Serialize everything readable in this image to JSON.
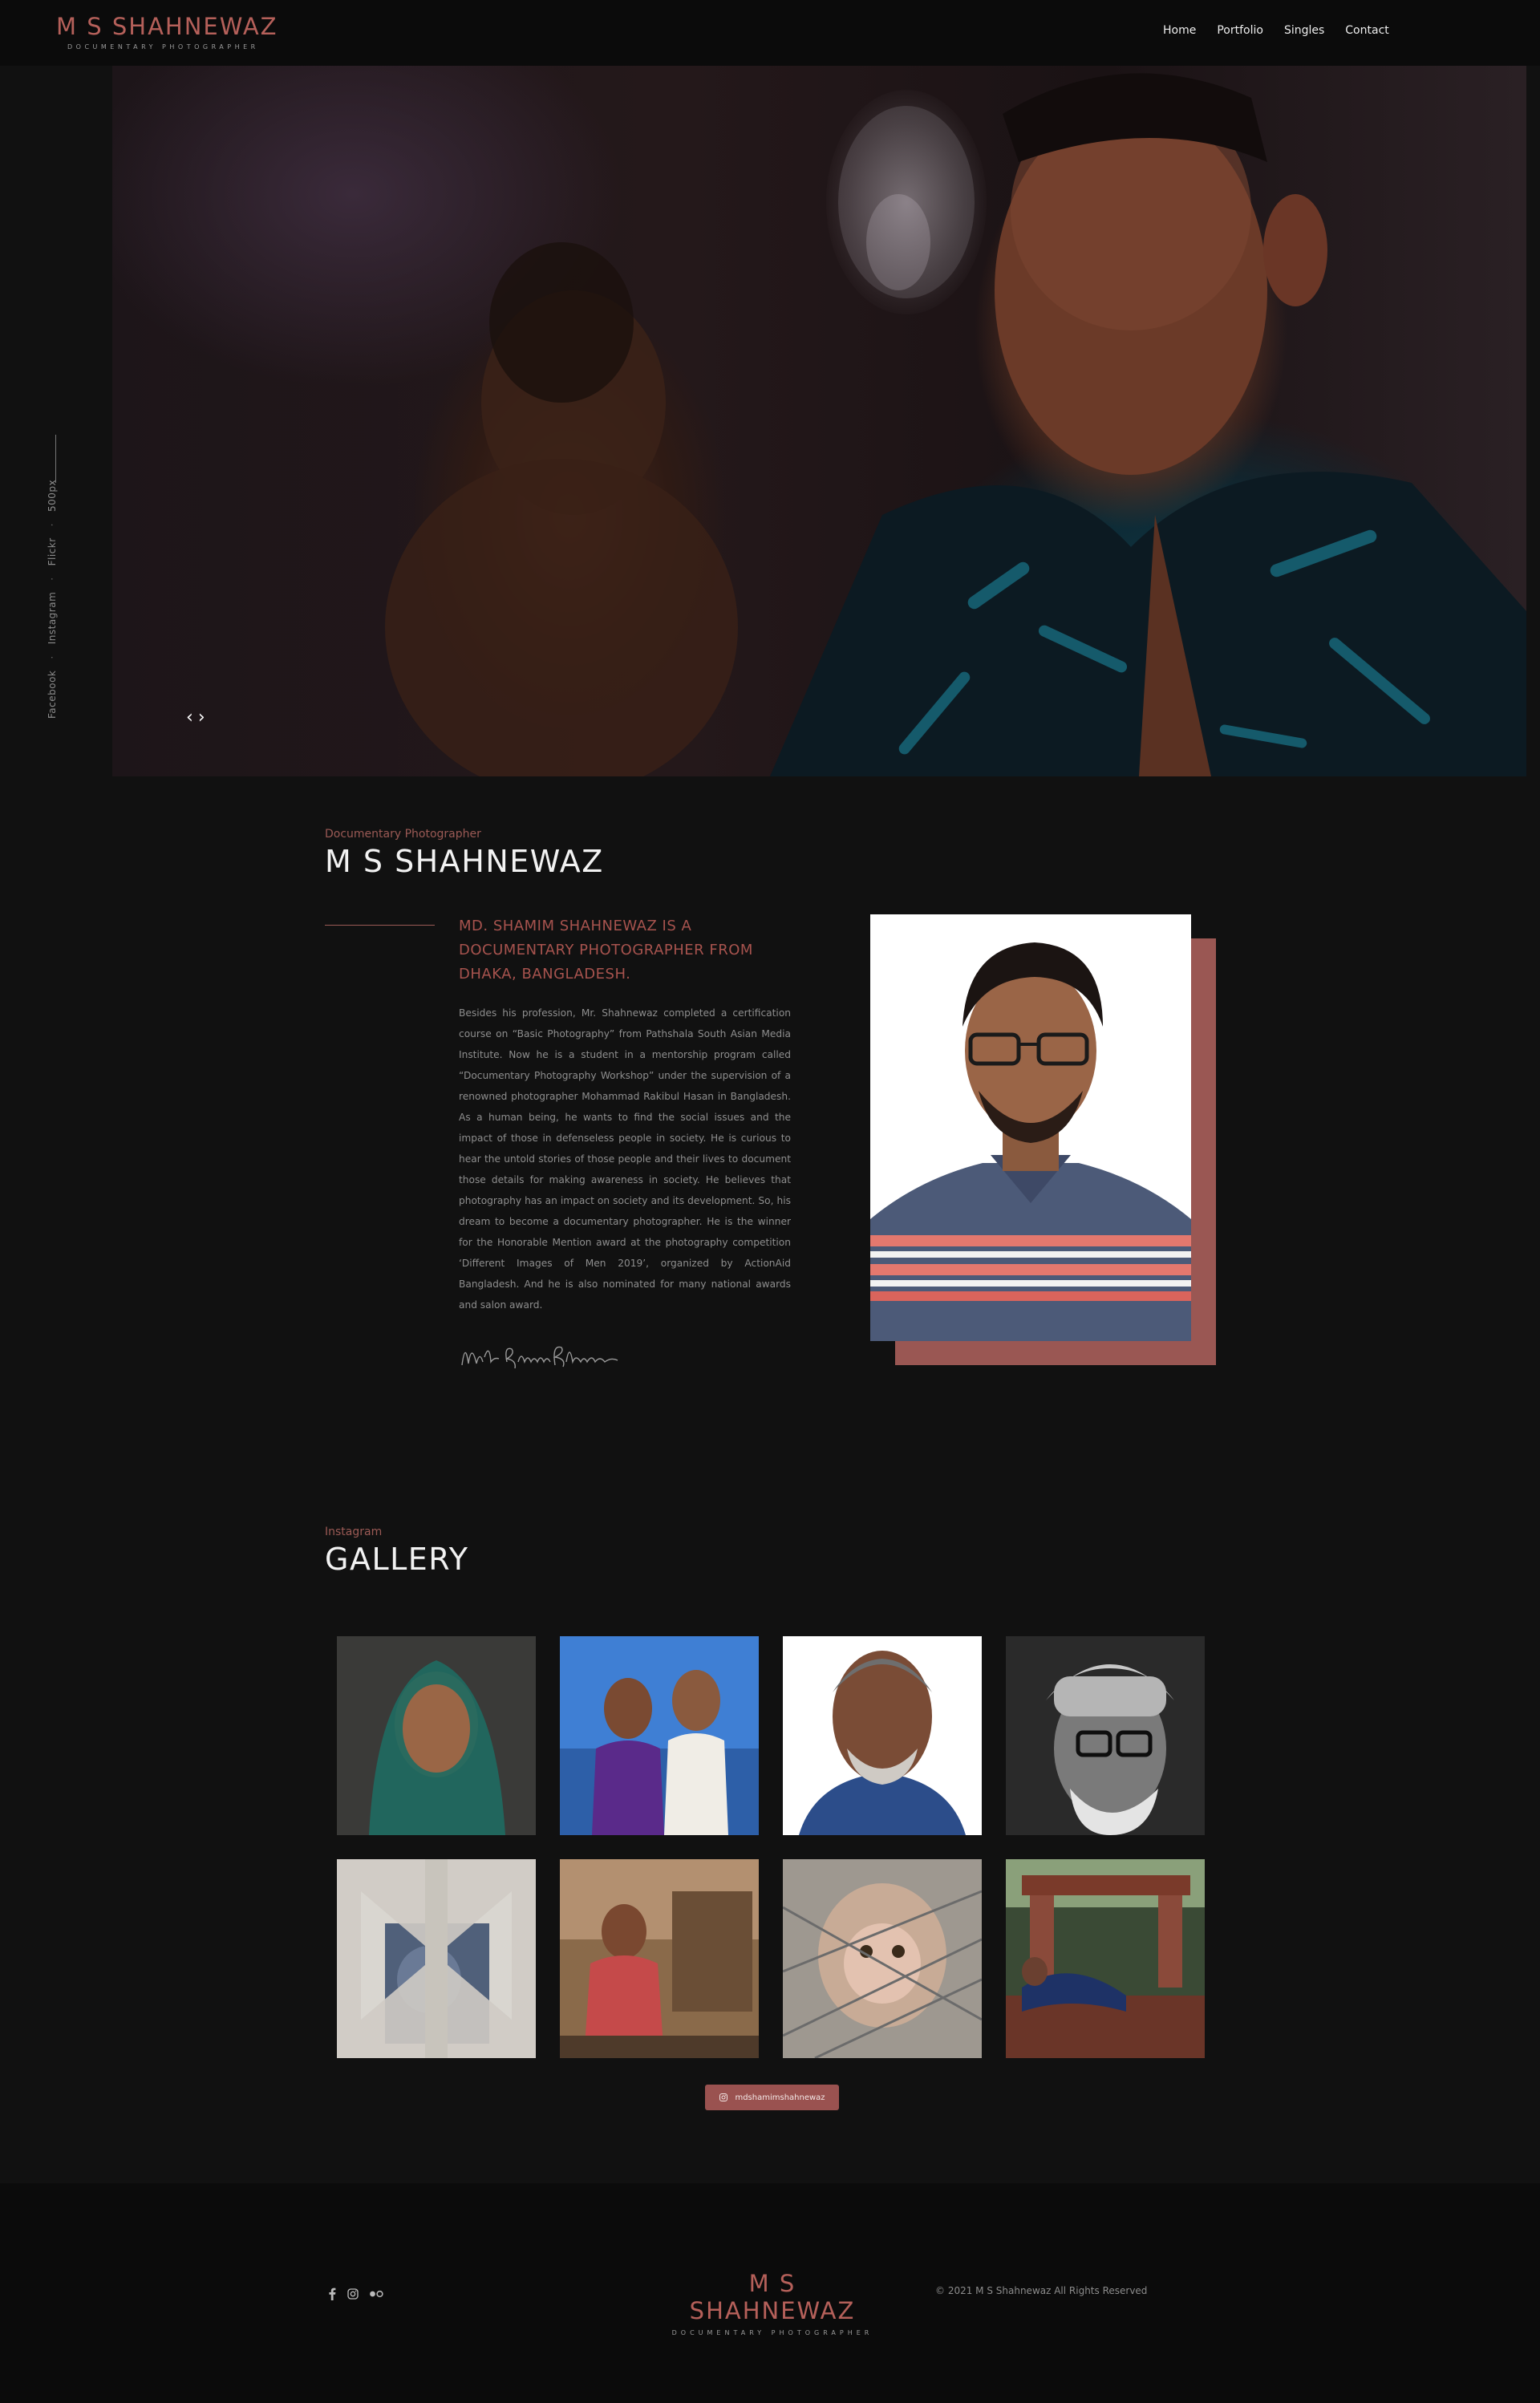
{
  "header": {
    "brand_title": "M S SHAHNEWAZ",
    "brand_subtitle": "DOCUMENTARY PHOTOGRAPHER",
    "nav": [
      "Home",
      "Portfolio",
      "Singles",
      "Contact"
    ]
  },
  "side_social": [
    "Facebook",
    "Instagram",
    "Flickr",
    "500px"
  ],
  "hero": {
    "prev_icon": "chevron-left-icon",
    "next_icon": "chevron-right-icon",
    "prev_label": "‹",
    "next_label": "›"
  },
  "about": {
    "kicker": "Documentary Photographer",
    "title": "M S SHAHNEWAZ",
    "lead": "MD. SHAMIM SHAHNEWAZ IS A DOCUMENTARY PHOTOGRAPHER FROM DHAKA, BANGLADESH.",
    "body": "Besides his profession, Mr. Shahnewaz completed a certification course on “Basic Photography” from Pathshala South Asian Media Institute. Now he is a student in a mentorship program called “Documentary Photography Workshop” under the supervision of a renowned photographer Mohammad Rakibul Hasan in Bangladesh. As a human being, he wants to find the social issues and the impact of those in defenseless people in society. He is curious to hear the untold stories of those people and their lives to document those details for making awareness in society. He believes that photography has an impact on society and its development. So, his dream to become a documentary photographer. He is the winner for the Honorable Mention award at the photography competition ‘Different Images of Men 2019’, organized by ActionAid Bangladesh. And he is also nominated for many national awards and salon award.",
    "signature": "Md. Shamim Shahnewaz"
  },
  "gallery": {
    "kicker": "Instagram",
    "title": "GALLERY",
    "button_label": "mdshamimshahnewaz",
    "button_icon": "instagram-icon"
  },
  "footer": {
    "social_icons": [
      "facebook-icon",
      "instagram-icon",
      "flickr-icon"
    ],
    "brand_title": "M S SHAHNEWAZ",
    "brand_subtitle": "DOCUMENTARY PHOTOGRAPHER",
    "copyright": "© 2021 M S Shahnewaz All Rights Reserved"
  },
  "colors": {
    "accent": "#b5605a",
    "accent_block": "#9a5753",
    "background": "#111111",
    "header_bg": "#0b0b0b"
  }
}
